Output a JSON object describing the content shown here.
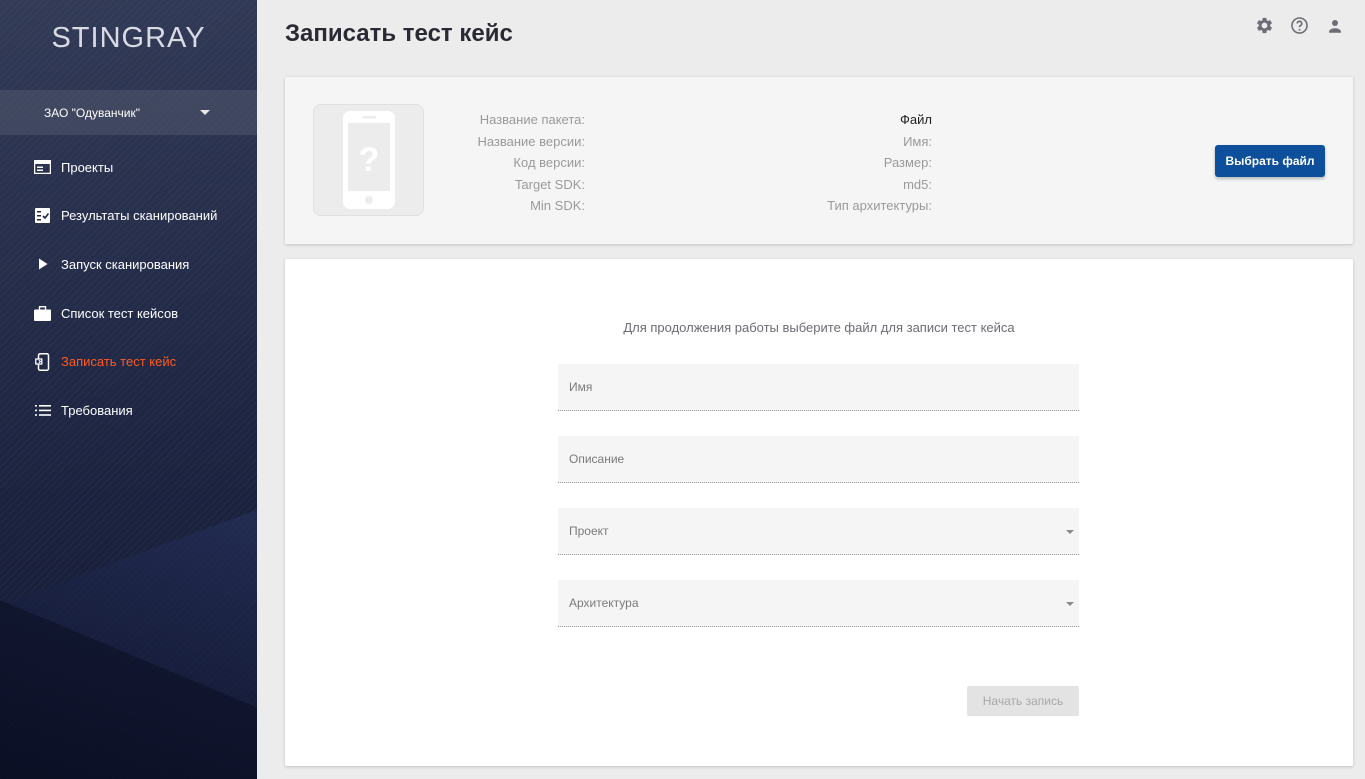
{
  "brand": {
    "logo": "STINGRAY"
  },
  "organization": {
    "name": "ЗАО \"Одуванчик\"",
    "icon": "chevron-down-icon"
  },
  "sidebar": {
    "items": [
      {
        "label": "Проекты",
        "icon": "projects-icon",
        "active": false
      },
      {
        "label": "Результаты сканирований",
        "icon": "scan-results-icon",
        "active": false
      },
      {
        "label": "Запуск сканирования",
        "icon": "play-icon",
        "active": false
      },
      {
        "label": "Список тест кейсов",
        "icon": "briefcase-icon",
        "active": false
      },
      {
        "label": "Записать тест кейс",
        "icon": "phone-record-icon",
        "active": true
      },
      {
        "label": "Требования",
        "icon": "list-icon",
        "active": false
      }
    ]
  },
  "header": {
    "title": "Записать тест кейс",
    "icons": [
      "gear-icon",
      "help-icon",
      "user-icon"
    ]
  },
  "package_info": {
    "left_labels": [
      "Название пакета:",
      "Название версии:",
      "Код версии:",
      "Target SDK:",
      "Min SDK:"
    ],
    "file_header": "Файл",
    "right_labels": [
      "Имя:",
      "Размер:",
      "md5:",
      "Тип архитектуры:"
    ],
    "choose_file_button": "Выбрать файл"
  },
  "form": {
    "hint": "Для продолжения работы выберите файл для записи тест кейса",
    "name_placeholder": "Имя",
    "description_placeholder": "Описание",
    "project_placeholder": "Проект",
    "architecture_placeholder": "Архитектура",
    "start_button": "Начать запись"
  },
  "colors": {
    "accent": "#ff5a1f",
    "primary_button": "#0d4f9b",
    "sidebar_bg": "#1f2745"
  }
}
